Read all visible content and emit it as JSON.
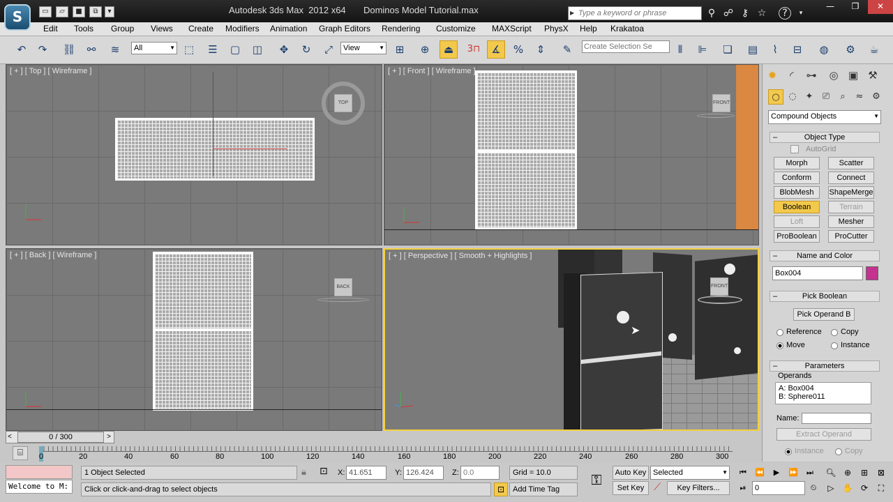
{
  "title_bar": {
    "app_logo": "S",
    "app_name": "Autodesk 3ds Max  2012 x64",
    "file_name": "Dominos Model Tutorial.max",
    "search_placeholder": "Type a keyword or phrase",
    "help_label": "?"
  },
  "menu": [
    "Edit",
    "Tools",
    "Group",
    "Views",
    "Create",
    "Modifiers",
    "Animation",
    "Graph Editors",
    "Rendering",
    "Customize",
    "MAXScript",
    "PhysX",
    "Help",
    "Krakatoa"
  ],
  "toolbar": {
    "filter_select": "All",
    "coord_select": "View",
    "snap_label": "3",
    "selection_set_placeholder": "Create Selection Se"
  },
  "viewports": {
    "top": {
      "label": "[ + ] [ Top ] [ Wireframe ]",
      "cube": "TOP"
    },
    "front": {
      "label": "[ + ] [ Front ] [ Wireframe ]",
      "cube": "FRONT"
    },
    "back": {
      "label": "[ + ] [ Back ] [ Wireframe ]",
      "cube": "BACK"
    },
    "perspective": {
      "label": "[ + ] [ Perspective ] [ Smooth + Highlights ]",
      "cube": "FRONT"
    }
  },
  "command_panel": {
    "category": "Compound Objects",
    "object_type": {
      "title": "Object Type",
      "autogrid": "AutoGrid",
      "buttons": [
        "Morph",
        "Scatter",
        "Conform",
        "Connect",
        "BlobMesh",
        "ShapeMerge",
        "Boolean",
        "Terrain",
        "Loft",
        "Mesher",
        "ProBoolean",
        "ProCutter"
      ]
    },
    "name_color": {
      "title": "Name and Color",
      "name": "Box004",
      "swatch": "#c3338f"
    },
    "pick_boolean": {
      "title": "Pick Boolean",
      "button": "Pick Operand B",
      "options": [
        "Reference",
        "Copy",
        "Move",
        "Instance"
      ]
    },
    "parameters": {
      "title": "Parameters",
      "operands_label": "Operands",
      "operands": [
        "A: Box004",
        "B: Sphere011"
      ],
      "name_label": "Name:",
      "extract_button": "Extract Operand",
      "extract_options": [
        "Instance",
        "Copy"
      ]
    }
  },
  "timeline": {
    "frame": "0 / 300",
    "ticks": [
      "0",
      "20",
      "40",
      "60",
      "80",
      "100",
      "120",
      "140",
      "160",
      "180",
      "200",
      "220",
      "240",
      "260",
      "280",
      "300"
    ]
  },
  "status": {
    "script": "Welcome to M:",
    "selected": "1 Object Selected",
    "prompt": "Click or click-and-drag to select objects",
    "x_label": "X:",
    "x_value": "41.651",
    "y_label": "Y:",
    "y_value": "126.424",
    "z_label": "Z:",
    "z_value": "0.0",
    "grid": "Grid = 10.0",
    "add_time_tag": "Add Time Tag",
    "auto_key": "Auto Key",
    "set_key": "Set Key",
    "key_mode": "Selected",
    "key_filters": "Key Filters...",
    "frame_field": "0"
  }
}
